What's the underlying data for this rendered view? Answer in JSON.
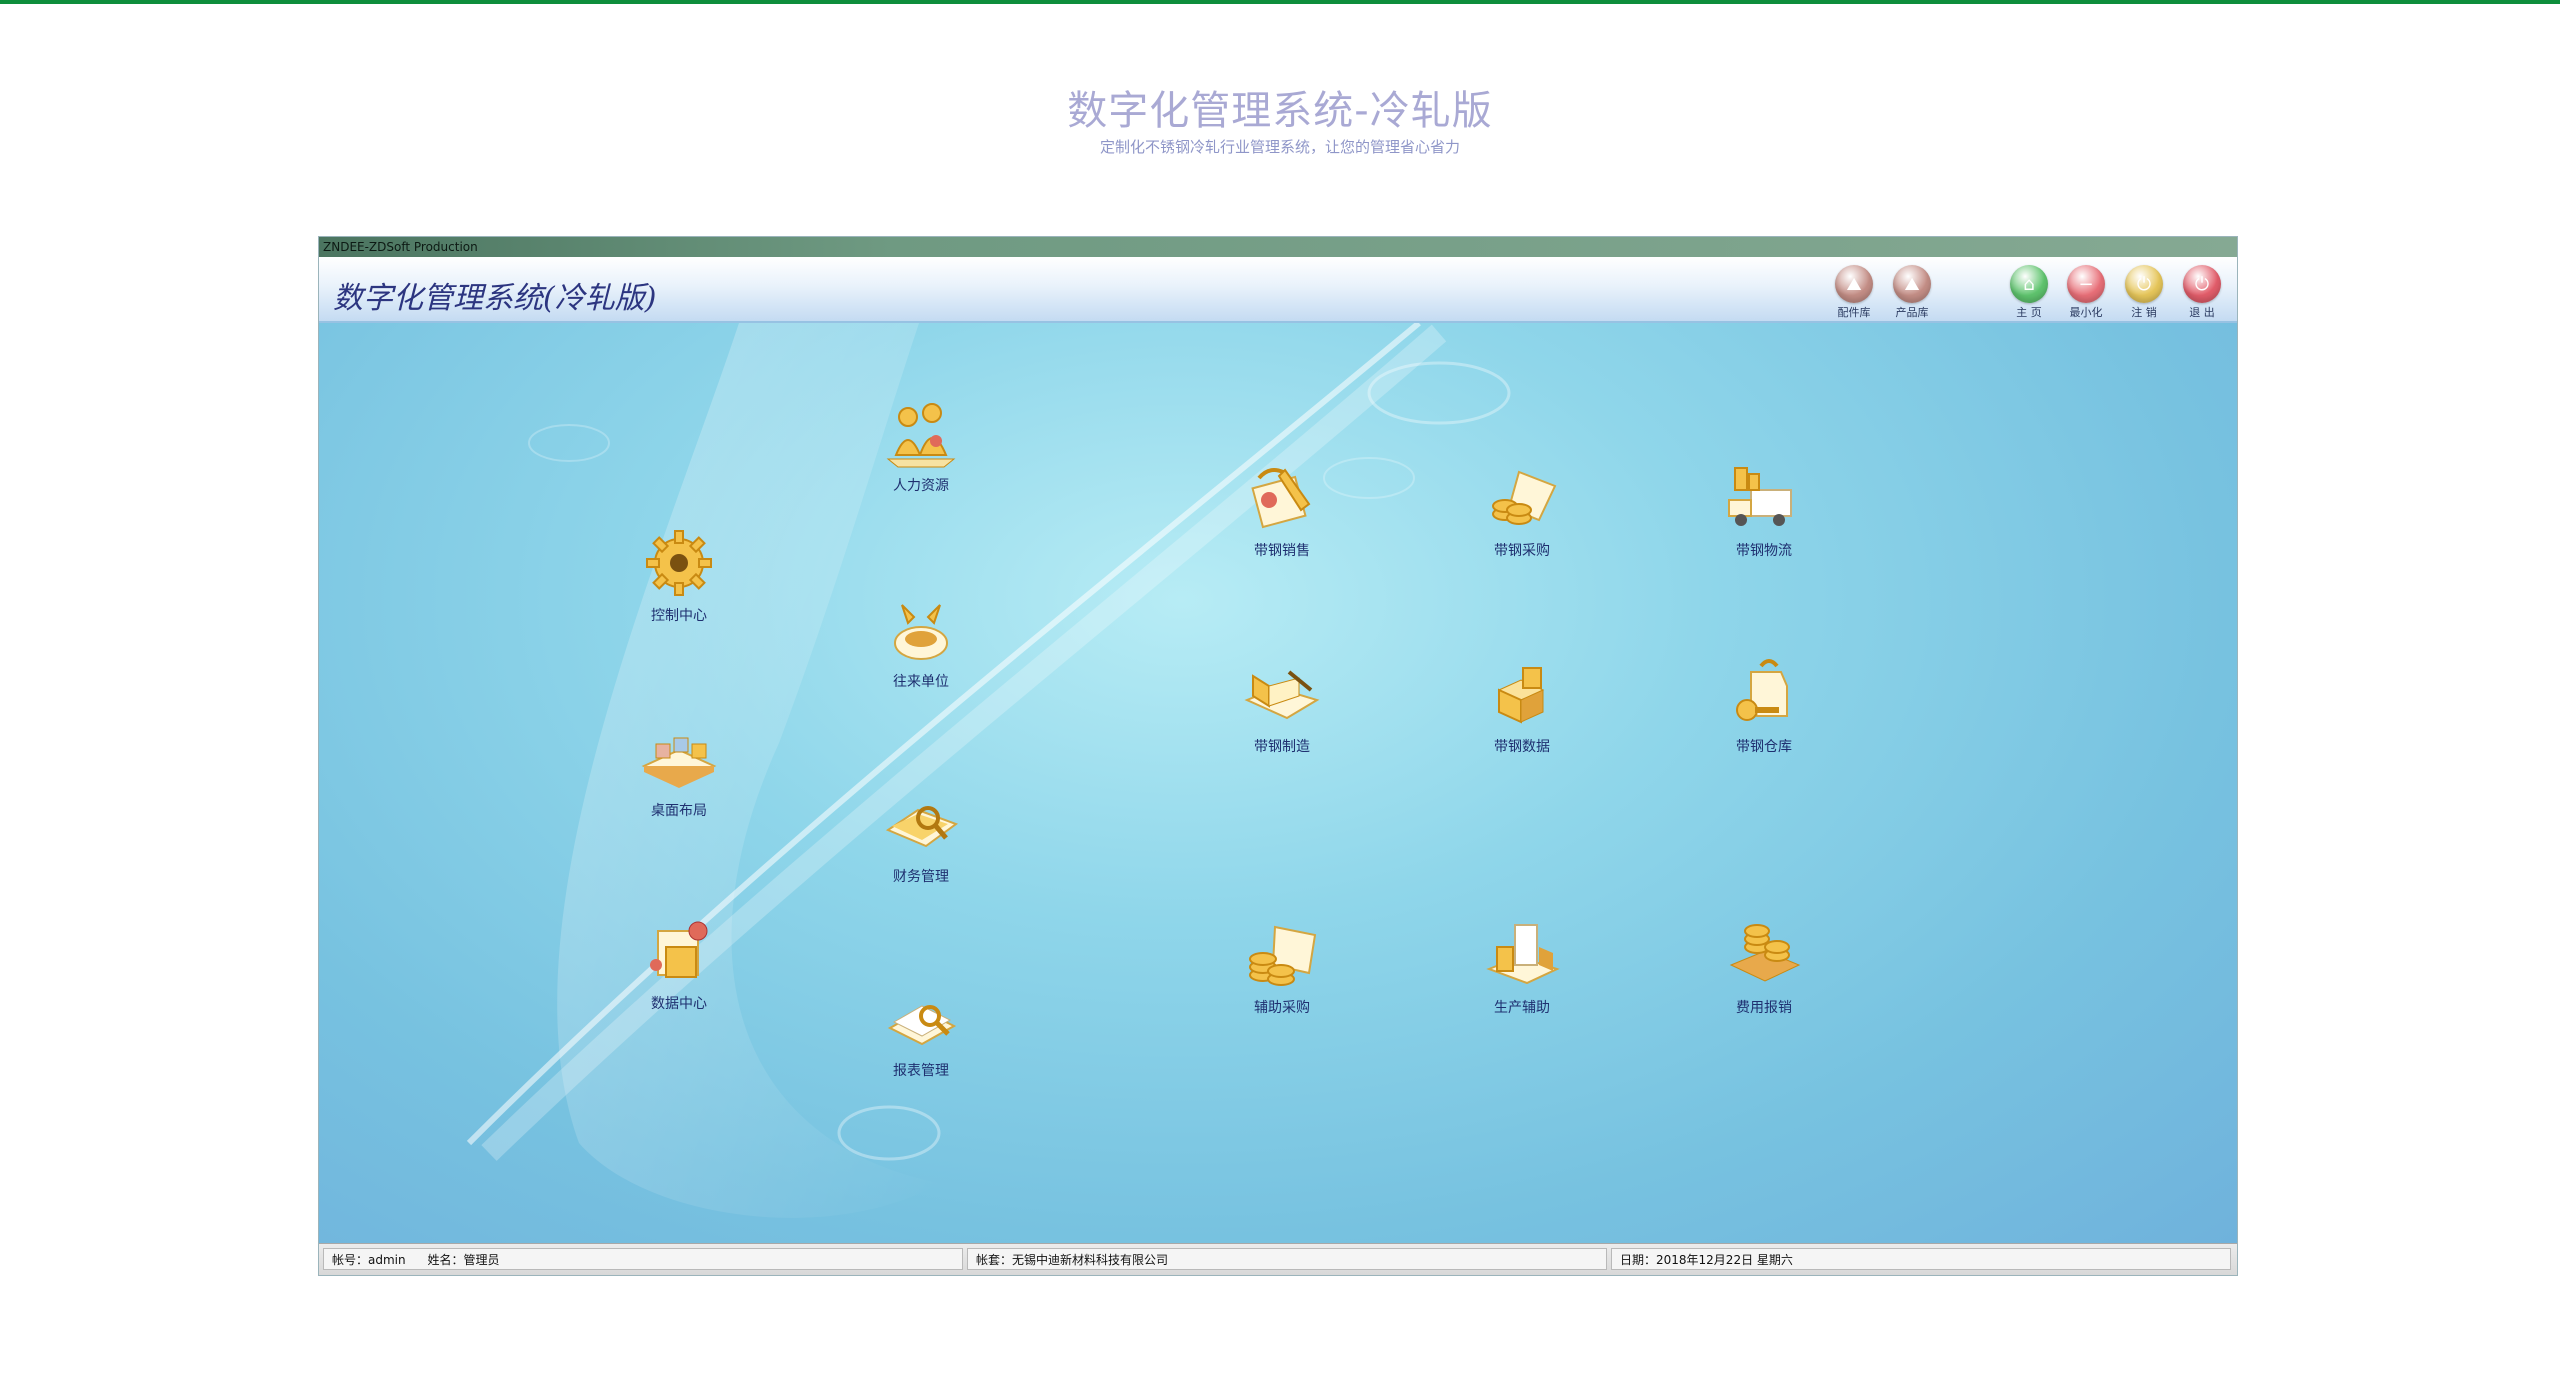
{
  "page": {
    "title": "数字化管理系统-冷轧版",
    "subtitle": "定制化不锈钢冷轧行业管理系统，让您的管理省心省力"
  },
  "window": {
    "caption": "ZNDEE-ZDSoft Production",
    "app_title": "数字化管理系统(冷轧版)",
    "toolbar": [
      {
        "key": "parts",
        "label": "配件库",
        "color": "#c48e86",
        "icon": "mountain-icon"
      },
      {
        "key": "products",
        "label": "产品库",
        "color": "#c48e86",
        "icon": "mountain-icon"
      },
      {
        "key": "home",
        "label": "主 页",
        "color": "#5fc46e",
        "icon": "home-icon"
      },
      {
        "key": "minimize",
        "label": "最小化",
        "color": "#e86f78",
        "icon": "minus-icon"
      },
      {
        "key": "logout",
        "label": "注 销",
        "color": "#e6c65a",
        "icon": "power-icon"
      },
      {
        "key": "exit",
        "label": "退 出",
        "color": "#e25d6a",
        "icon": "power-icon"
      }
    ]
  },
  "desktop": {
    "left_icons": [
      {
        "label": "控制中心",
        "icon": "gear-icon"
      },
      {
        "label": "桌面布局",
        "icon": "layout-icon"
      },
      {
        "label": "数据中心",
        "icon": "database-icon"
      }
    ],
    "middle_icons": [
      {
        "label": "人力资源",
        "icon": "people-icon"
      },
      {
        "label": "往来单位",
        "icon": "handshake-icon"
      },
      {
        "label": "财务管理",
        "icon": "finance-icon"
      },
      {
        "label": "报表管理",
        "icon": "report-icon"
      }
    ],
    "grid_icons": [
      {
        "label": "带钢销售",
        "icon": "sales-icon"
      },
      {
        "label": "带钢采购",
        "icon": "purchase-icon"
      },
      {
        "label": "带钢物流",
        "icon": "truck-icon"
      },
      {
        "label": "带钢制造",
        "icon": "manufacture-icon"
      },
      {
        "label": "带钢数据",
        "icon": "data-boxes-icon"
      },
      {
        "label": "带钢仓库",
        "icon": "warehouse-icon"
      },
      {
        "label": "辅助采购",
        "icon": "coins-icon"
      },
      {
        "label": "生产辅助",
        "icon": "production-icon"
      },
      {
        "label": "费用报销",
        "icon": "expense-icon"
      }
    ]
  },
  "status": {
    "account": "帐号：admin",
    "name": "姓名：管理员",
    "book": "帐套：无锡中迪新材料科技有限公司",
    "date": "日期：2018年12月22日 星期六"
  },
  "colors": {
    "accent_green": "#0e8e3c",
    "desktop_blue": "#8fd6ea",
    "icon_gold": "#f2c14a"
  }
}
